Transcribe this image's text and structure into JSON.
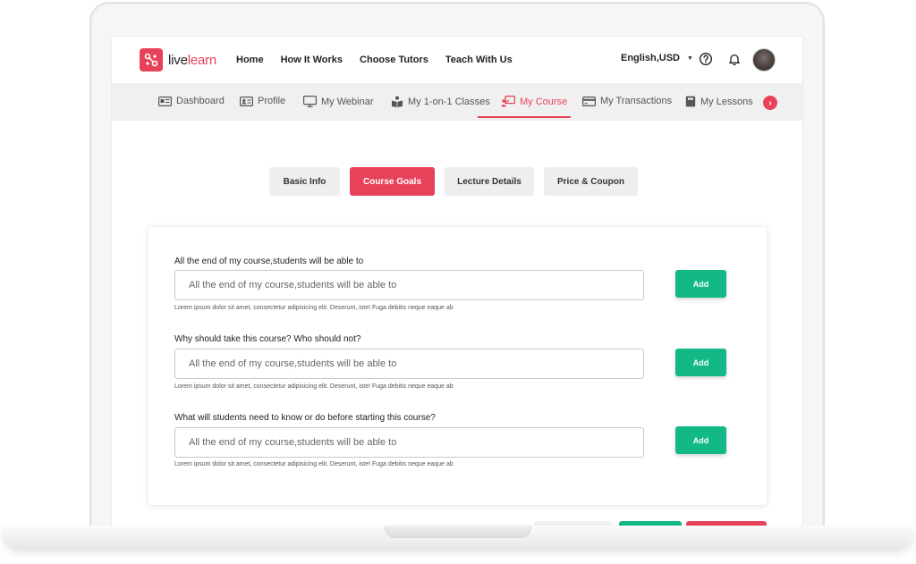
{
  "brand": {
    "name_part1": "live",
    "name_part2": "learn",
    "accent": "#e8425a"
  },
  "header": {
    "nav": [
      "Home",
      "How It Works",
      "Choose Tutors",
      "Teach With Us"
    ],
    "language": "English,USD"
  },
  "dashboard_tabs": [
    {
      "label": "Dashboard",
      "icon": "dashboard-icon"
    },
    {
      "label": "Profile",
      "icon": "profile-card-icon"
    },
    {
      "label": "My Webinar",
      "icon": "monitor-icon"
    },
    {
      "label": "My 1-on-1 Classes",
      "icon": "book-user-icon"
    },
    {
      "label": "My Course",
      "icon": "presentation-icon",
      "active": true
    },
    {
      "label": "My Transactions",
      "icon": "credit-card-icon"
    },
    {
      "label": "My Lessons",
      "icon": "notebook-icon"
    }
  ],
  "steps": [
    "Basic Info",
    "Course Goals",
    "Lecture Details",
    "Price & Coupon"
  ],
  "active_step": "Course Goals",
  "form": {
    "questions": [
      {
        "label": "All the end of my course,students will be able to",
        "placeholder": "All the end of my course,students will be able to",
        "help": "Lorem ipsum dolor sit amet, consectetur adipisicing elit. Deserunt, iste! Fuga debitis neque eaque ab",
        "button": "Add"
      },
      {
        "label": "Why should take this course? Who should not?",
        "placeholder": "All the end of my course,students will be able to",
        "help": "Lorem ipsum dolor sit amet, consectetur adipisicing elit. Deserunt, iste! Fuga debitis neque eaque ab",
        "button": "Add"
      },
      {
        "label": "What will students need to know or do before starting this course?",
        "placeholder": "All the end of my course,students will be able to",
        "help": "Lorem ipsum dolor sit amet, consectetur adipisicing elit. Deserunt, iste! Fuga debitis neque eaque ab",
        "button": "Add"
      }
    ]
  },
  "colors": {
    "primary": "#e8425a",
    "success": "#12b886",
    "tab_bg": "#f0f0f0",
    "step_bg": "#eeeeee"
  }
}
